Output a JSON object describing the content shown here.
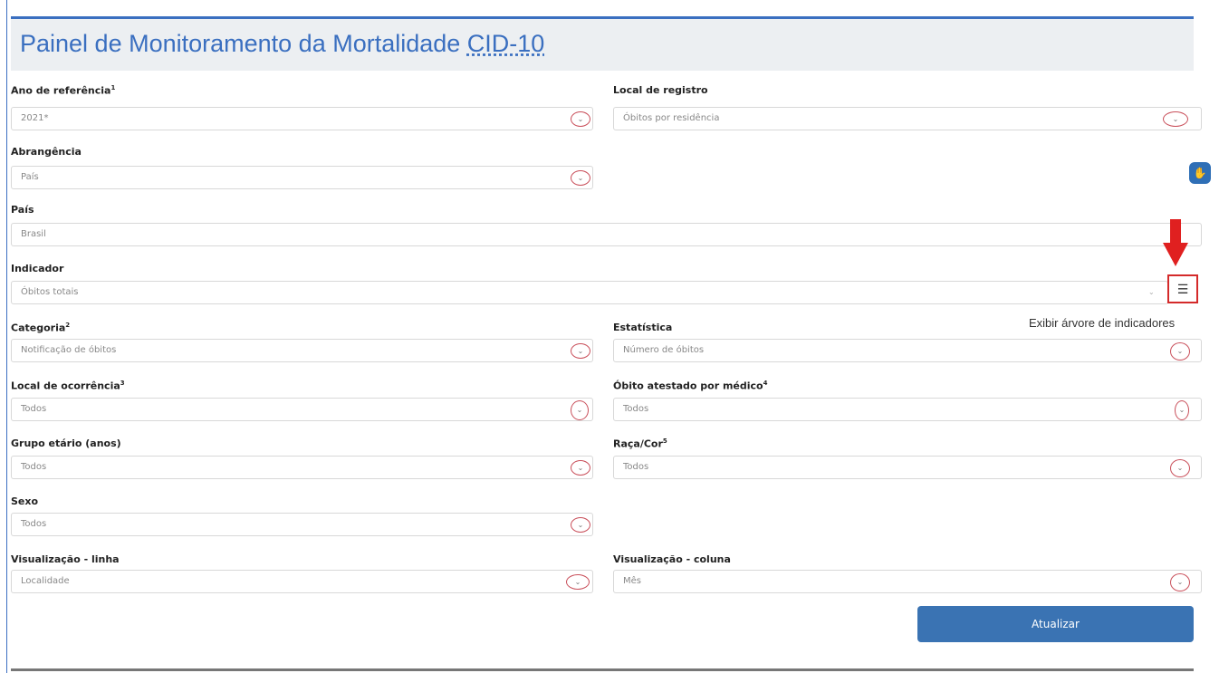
{
  "title": {
    "main": "Painel de Monitoramento da Mortalidade ",
    "cid": "CID-10"
  },
  "fields": {
    "ano": {
      "label": "Ano de referência",
      "sup": "1",
      "value": "2021*"
    },
    "local_registro": {
      "label": "Local de registro",
      "value": "Óbitos por residência"
    },
    "abrangencia": {
      "label": "Abrangência",
      "value": "País"
    },
    "pais": {
      "label": "País",
      "value": "Brasil"
    },
    "indicador": {
      "label": "Indicador",
      "value": "Óbitos totais"
    },
    "categoria": {
      "label": "Categoria",
      "sup": "2",
      "value": "Notificação de óbitos"
    },
    "estatistica": {
      "label": "Estatística",
      "value": "Número de óbitos"
    },
    "local_ocorrencia": {
      "label": "Local de ocorrência",
      "sup": "3",
      "value": "Todos"
    },
    "atestado": {
      "label": "Óbito atestado por médico",
      "sup": "4",
      "value": "Todos"
    },
    "grupo_etario": {
      "label": "Grupo etário (anos)",
      "value": "Todos"
    },
    "raca": {
      "label": "Raça/Cor",
      "sup": "5",
      "value": "Todos"
    },
    "sexo": {
      "label": "Sexo",
      "value": "Todos"
    },
    "vis_linha": {
      "label": "Visualização - linha",
      "value": "Localidade"
    },
    "vis_coluna": {
      "label": "Visualização - coluna",
      "value": "Mês"
    }
  },
  "tooltip": "Exibir árvore de indicadores",
  "buttons": {
    "atualizar": "Atualizar"
  },
  "icons": {
    "dropdown": "chevron-down-icon",
    "indicator_tree": "list-icon",
    "side": "accessibility-icon"
  },
  "colors": {
    "accent": "#3a6fc0",
    "highlight": "#d42a2a",
    "button": "#3a73b3"
  }
}
